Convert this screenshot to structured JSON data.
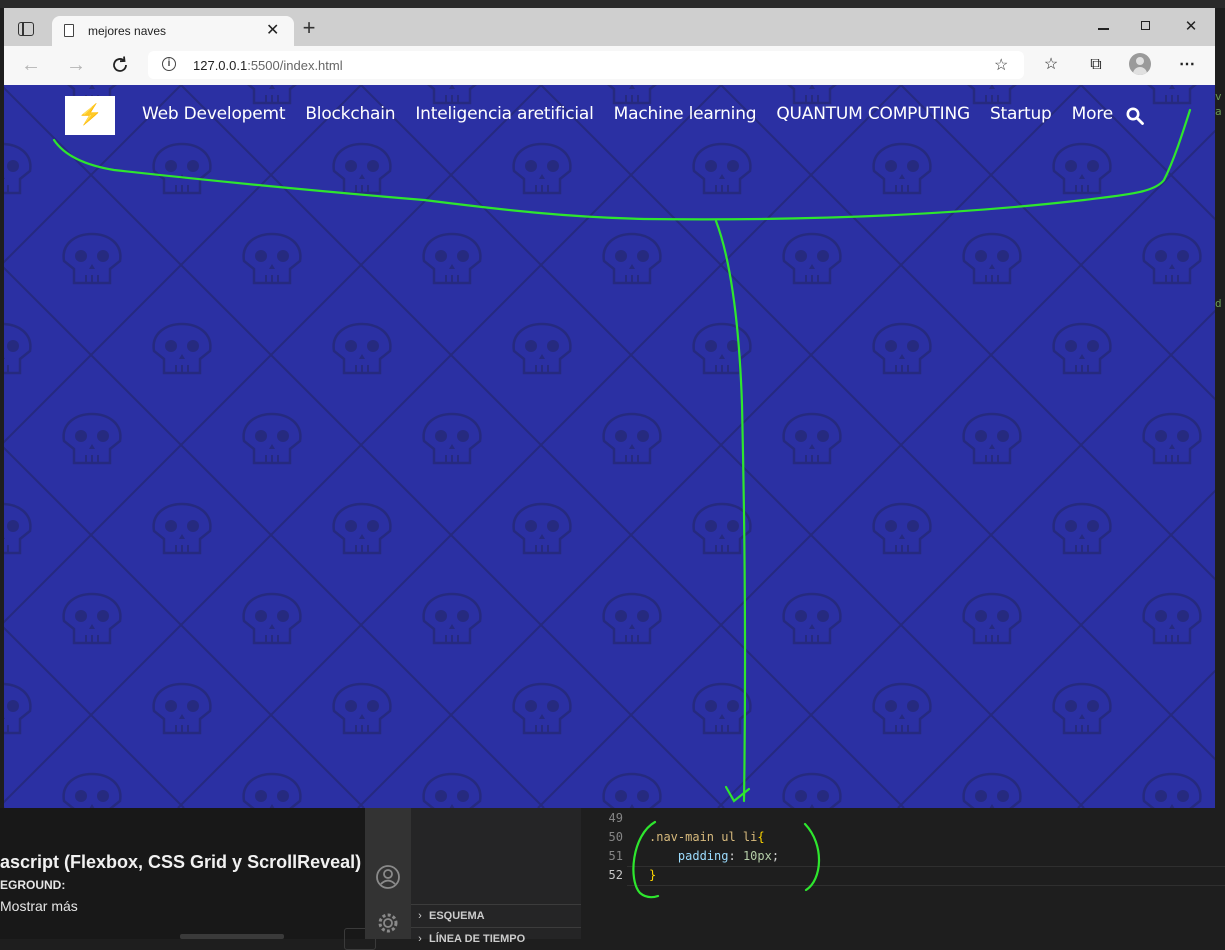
{
  "browser": {
    "tab_title": "mejores naves",
    "url_host": "127.0.0.1",
    "url_rest": ":5500/index.html"
  },
  "site": {
    "logo_glyph": "⚡",
    "menu": [
      "Web Developemt",
      "Blockchain",
      "Inteligencia aretificial",
      "Machine learning",
      "QUANTUM COMPUTING",
      "Startup",
      "More"
    ],
    "bg_color": "#2b30a3",
    "pattern_color": "#262a7f"
  },
  "youtube": {
    "title_fragment": "ascript (Flexbox, CSS Grid y ScrollReveal) | T",
    "channel_fragment": "EGROUND:",
    "show_more": "Mostrar más"
  },
  "vscode": {
    "sections": [
      "ESQUEMA",
      "LÍNEA DE TIEMPO"
    ],
    "code_lines": [
      {
        "num": "49",
        "text": ""
      },
      {
        "num": "50",
        "selector": ".nav-main ul li",
        "open": "{"
      },
      {
        "num": "51",
        "prop": "padding",
        "value": "10px"
      },
      {
        "num": "52",
        "close": "}"
      }
    ]
  },
  "annotation_color": "#2ee62e"
}
